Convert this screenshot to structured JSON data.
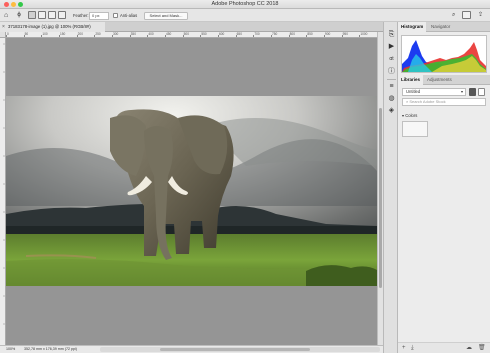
{
  "app_title": "Adobe Photoshop CC 2018",
  "options_bar": {
    "feather_label": "Feather:",
    "feather_value": "0 px",
    "anti_alias_label": "Anti-alias",
    "select_mask_label": "Select and Mask..."
  },
  "document": {
    "tab_label": "37183178-image (1).jpg @ 100% (RGB/8#)",
    "close_glyph": "×"
  },
  "ruler": {
    "ticks": [
      "0",
      "50",
      "100",
      "150",
      "200",
      "250",
      "300",
      "350",
      "400",
      "450",
      "500",
      "550",
      "600",
      "650",
      "700",
      "750",
      "800",
      "850",
      "900",
      "950",
      "1000"
    ]
  },
  "status_bar": {
    "zoom": "100%",
    "doc_size": "352,78 mm x 176,39 mm (72 ppi)"
  },
  "panels": {
    "top_tabs": [
      "Histogram",
      "Navigator"
    ],
    "mid_tabs": [
      "Libraries",
      "Adjustments"
    ],
    "library_select": "Untitled",
    "search_placeholder": "Search Adobe Stock",
    "colors_label": "Colors"
  },
  "colors": {
    "accent": "#1473e6",
    "histogram_red": "#e8312d",
    "histogram_green": "#2fc42f",
    "histogram_blue": "#1c3cf0",
    "histogram_yellow": "#e6d23a"
  }
}
